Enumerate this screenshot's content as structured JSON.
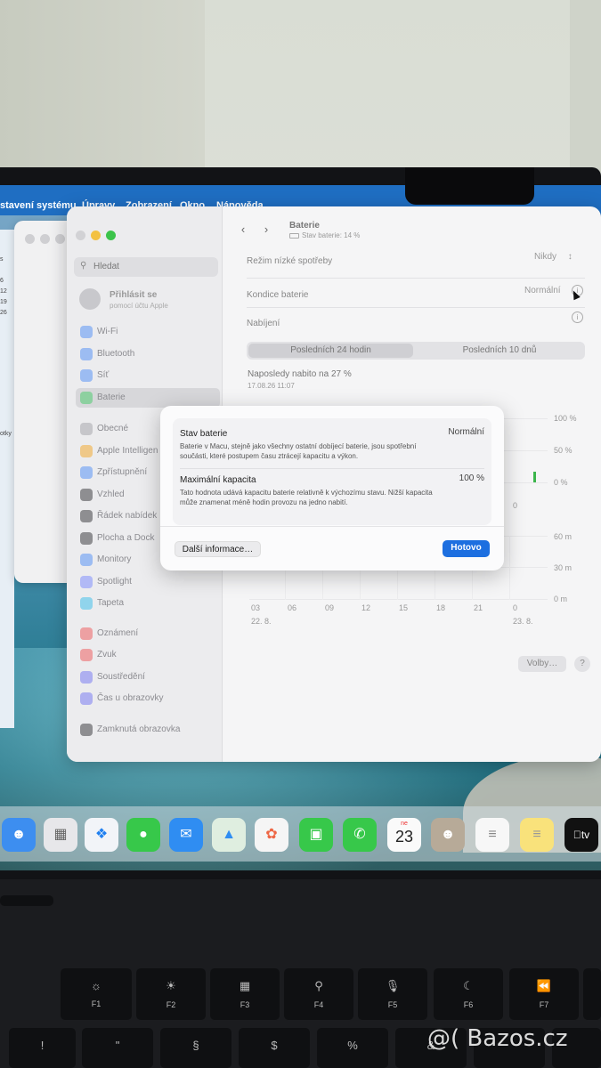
{
  "menubar": {
    "items": [
      "stavení systému",
      "Úpravy",
      "Zobrazení",
      "Okno",
      "Nápověda"
    ]
  },
  "left_edge_text": [
    "s",
    "6",
    "12",
    "19",
    "26",
    "otky"
  ],
  "sidebar": {
    "search_placeholder": "Hledat",
    "account_name": "Přihlásit se",
    "account_sub": "pomocí účtu Apple",
    "items": [
      {
        "label": "Wi-Fi",
        "color": "#3b82f6"
      },
      {
        "label": "Bluetooth",
        "color": "#3b82f6"
      },
      {
        "label": "Síť",
        "color": "#3b82f6"
      },
      {
        "label": "Baterie",
        "color": "#34c759"
      },
      {
        "label": "Obecné",
        "color": "#9a9a9e"
      },
      {
        "label": "Apple Intelligen",
        "color": "#f59e0b"
      },
      {
        "label": "Zpřístupnění",
        "color": "#3b82f6"
      },
      {
        "label": "Vzhled",
        "color": "#1c1c1e"
      },
      {
        "label": "Řádek nabídek",
        "color": "#1c1c1e"
      },
      {
        "label": "Plocha a Dock",
        "color": "#1c1c1e"
      },
      {
        "label": "Monitory",
        "color": "#3b82f6"
      },
      {
        "label": "Spotlight",
        "color": "#6b7cff"
      },
      {
        "label": "Tapeta",
        "color": "#22b8e8"
      },
      {
        "label": "Oznámení",
        "color": "#ef4444"
      },
      {
        "label": "Zvuk",
        "color": "#ef4444"
      },
      {
        "label": "Soustředění",
        "color": "#6366f1"
      },
      {
        "label": "Čas u obrazovky",
        "color": "#6366f1"
      },
      {
        "label": "Zamknutá obrazovka",
        "color": "#1c1c1e"
      }
    ]
  },
  "content": {
    "title": "Baterie",
    "subtitle": "Stav baterie: 14 %",
    "low_power_label": "Režim nízké spotřeby",
    "low_power_value": "Nikdy",
    "health_label": "Kondice baterie",
    "health_value": "Normální",
    "charging_label": "Nabíjení",
    "tabs": [
      "Posledních 24 hodin",
      "Posledních 10 dnů"
    ],
    "last_charged": "Naposledy nabito na 27 %",
    "last_charged_date": "17.08.26 11:07",
    "level_axis": [
      "100 %",
      "50 %",
      "0 %"
    ],
    "usage_axis": [
      "60 m",
      "30 m",
      "0 m"
    ],
    "x_ticks": [
      "03",
      "06",
      "09",
      "12",
      "15",
      "18",
      "21",
      "0"
    ],
    "x_dates": [
      "22. 8.",
      "23. 8."
    ],
    "hidden_tick": "0",
    "options_label": "Volby…",
    "help_label": "?"
  },
  "dialog": {
    "status_title": "Stav baterie",
    "status_value": "Normální",
    "status_desc": "Baterie v Macu, stejně jako všechny ostatní dobíjecí baterie, jsou spotřební součásti, které postupem času ztrácejí kapacitu a výkon.",
    "capacity_title": "Maximální kapacita",
    "capacity_value": "100 %",
    "capacity_desc": "Tato hodnota udává kapacitu baterie relativně k výchozímu stavu. Nižší kapacita může znamenat méně hodin provozu na jedno nabití.",
    "more_info": "Další informace…",
    "done": "Hotovo"
  },
  "dock": {
    "calendar_month": "ne",
    "calendar_day": "23",
    "tv_label": "tv"
  },
  "keyboard": {
    "fkeys": [
      "F1",
      "F2",
      "F3",
      "F4",
      "F5",
      "F6",
      "F7"
    ],
    "number_row": [
      "!",
      "\"",
      "§",
      "$",
      "%",
      "&"
    ]
  },
  "watermark": "@( Bazos.cz"
}
